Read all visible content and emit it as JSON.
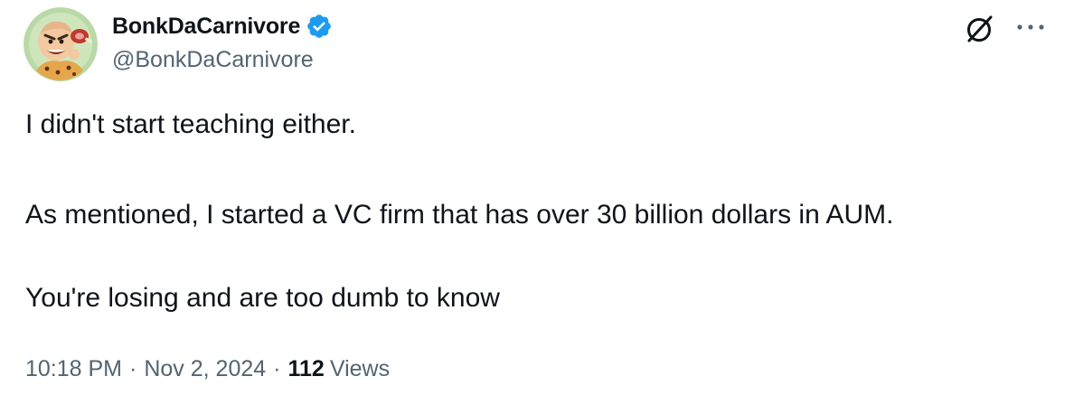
{
  "author": {
    "display_name": "BonkDaCarnivore",
    "handle": "@BonkDaCarnivore",
    "verified": true,
    "verified_color": "#1d9bf0"
  },
  "actions": {
    "grok_icon": "grok-icon",
    "more_icon": "more-icon"
  },
  "tweet": {
    "lines": [
      "I didn't start teaching either.",
      "As mentioned, I started a VC firm that has over 30 billion dollars in AUM.",
      "You're losing and are too dumb to know"
    ]
  },
  "meta": {
    "time": "10:18 PM",
    "date": "Nov 2, 2024",
    "separator": "·",
    "views_count": "112",
    "views_label": "Views"
  },
  "colors": {
    "text_primary": "#0f1419",
    "text_secondary": "#536471",
    "background": "#ffffff"
  }
}
